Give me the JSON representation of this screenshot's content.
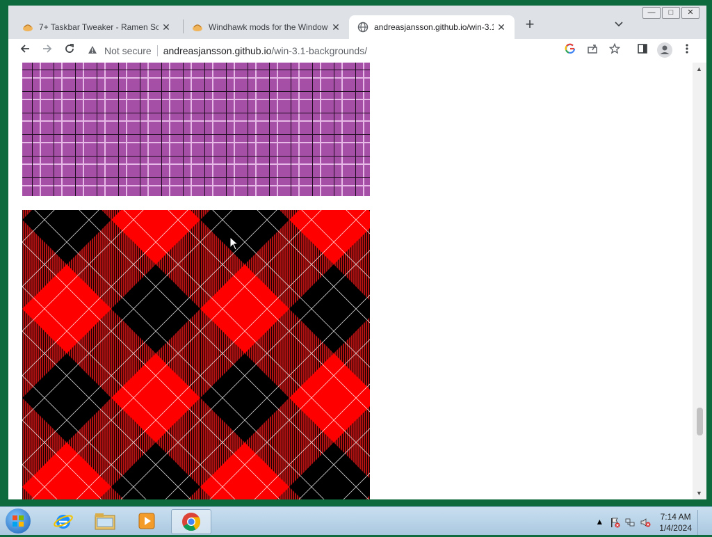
{
  "browser": {
    "tabs": [
      {
        "title": "7+ Taskbar Tweaker - Ramen Sof",
        "active": false
      },
      {
        "title": "Windhawk mods for the Window",
        "active": false
      },
      {
        "title": "andreasjansson.github.io/win-3.1",
        "active": true
      }
    ],
    "new_tab_label": "+",
    "window_controls": {
      "minimize": "—",
      "maximize": "□",
      "close": "✕"
    },
    "toolbar": {
      "security_label": "Not secure",
      "url_host": "andreasjansson.github.io",
      "url_path": "/win-3.1-backgrounds/"
    }
  },
  "content": {
    "tiles": [
      {
        "name": "purple-squares-pattern",
        "color": "#a64fa6"
      },
      {
        "name": "red-black-argyle-pattern",
        "color": "#ff0000"
      }
    ]
  },
  "taskbar": {
    "apps": [
      {
        "name": "internet-explorer"
      },
      {
        "name": "file-explorer"
      },
      {
        "name": "media-player"
      },
      {
        "name": "chrome",
        "active": true
      }
    ],
    "clock": {
      "time": "7:14 AM",
      "date": "1/4/2024"
    }
  }
}
